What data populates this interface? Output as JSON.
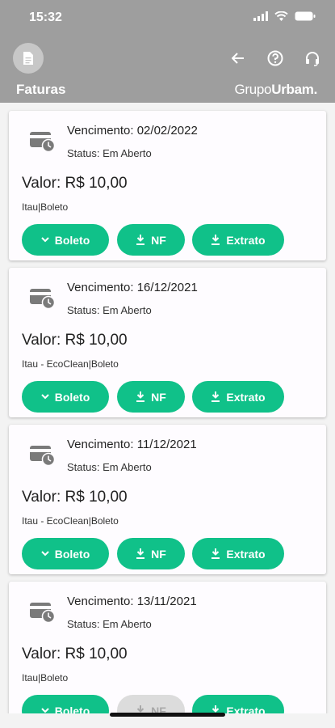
{
  "status_bar": {
    "time": "15:32"
  },
  "header": {
    "title": "Faturas",
    "brand_part1": "Grupo",
    "brand_part2": "Urbam.",
    "icons": [
      "document-icon",
      "arrow-left-icon",
      "help-icon",
      "headset-icon"
    ],
    "background_color": "#9e9e9e"
  },
  "invoices": [
    {
      "due_label": "Vencimento: 02/02/2022",
      "status": "Status: Em Aberto",
      "amount": "Valor: R$ 10,00",
      "bank": "Itau|Boleto",
      "nf_enabled": true
    },
    {
      "due_label": "Vencimento: 16/12/2021",
      "status": "Status: Em Aberto",
      "amount": "Valor: R$ 10,00",
      "bank": "Itau - EcoClean|Boleto",
      "nf_enabled": true
    },
    {
      "due_label": "Vencimento: 11/12/2021",
      "status": "Status: Em Aberto",
      "amount": "Valor: R$ 10,00",
      "bank": "Itau - EcoClean|Boleto",
      "nf_enabled": true
    },
    {
      "due_label": "Vencimento: 13/11/2021",
      "status": "Status: Em Aberto",
      "amount": "Valor: R$ 10,00",
      "bank": "Itau|Boleto",
      "nf_enabled": false
    }
  ],
  "buttons": {
    "boleto": "Boleto",
    "nf": "NF",
    "extrato": "Extrato"
  },
  "colors": {
    "accent": "#10c189",
    "disabled": "#dcdcdc"
  }
}
